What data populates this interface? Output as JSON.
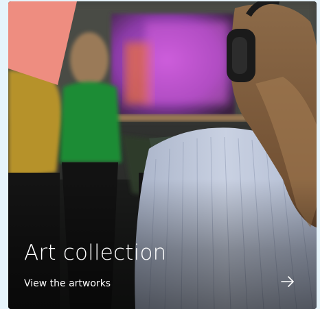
{
  "card": {
    "title": "Art collection",
    "link_label": "View the artworks",
    "arrow_icon": "arrow-right-icon",
    "accent_shape_color": "#ee8d80",
    "photo_description_icon": "photo-image"
  },
  "colors": {
    "page_background": "#e6f4fb",
    "text": "#ffffff",
    "accent": "#ee8d80"
  }
}
